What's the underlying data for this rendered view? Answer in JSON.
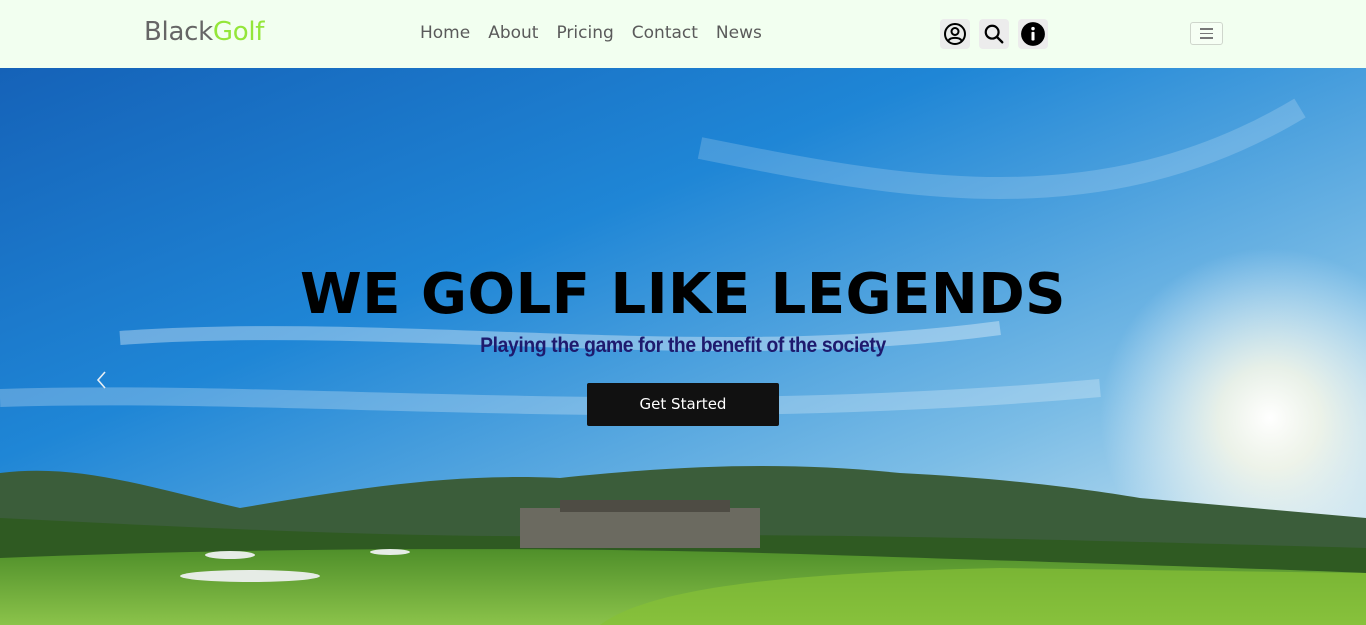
{
  "brand": {
    "part1": "Black",
    "part2": "Golf",
    "accent_color": "#94e63a"
  },
  "nav": {
    "links": [
      {
        "label": "Home"
      },
      {
        "label": "About"
      },
      {
        "label": "Pricing"
      },
      {
        "label": "Contact"
      },
      {
        "label": "News"
      }
    ],
    "icons": [
      "user-circle-icon",
      "search-icon",
      "info-icon"
    ],
    "menu_toggle_icon": "hamburger-icon"
  },
  "hero": {
    "title": "WE GOLF LIKE LEGENDS",
    "subtitle": "Playing the game for the benefit of the society",
    "cta_label": "Get Started",
    "prev_control_icon": "chevron-left-icon",
    "title_color": "#000000",
    "subtitle_color": "#1e1a6e",
    "cta_bg": "#111111"
  }
}
